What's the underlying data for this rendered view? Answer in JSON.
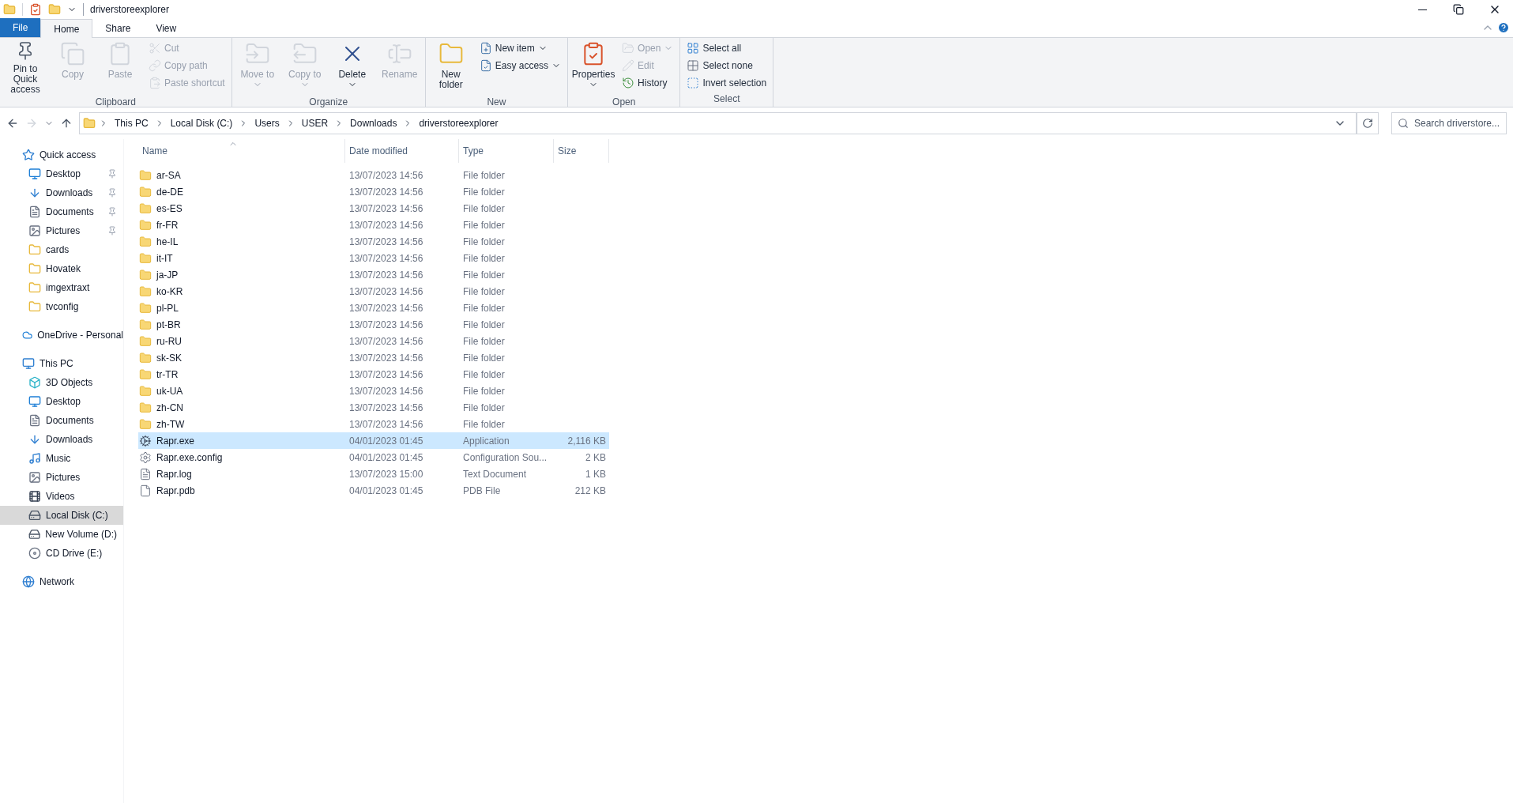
{
  "window": {
    "title": "driverstoreexplorer"
  },
  "ribbon_tabs": [
    {
      "label": "File",
      "kind": "file",
      "selected": false
    },
    {
      "label": "Home",
      "kind": "tab",
      "selected": true
    },
    {
      "label": "Share",
      "kind": "tab",
      "selected": false
    },
    {
      "label": "View",
      "kind": "tab",
      "selected": false
    }
  ],
  "ribbon_groups": [
    {
      "label": "Clipboard",
      "buttons": [
        {
          "label": "Pin to Quick access",
          "kind": "large",
          "disabled": false,
          "dropdown": false
        },
        {
          "label": "Copy",
          "kind": "large",
          "disabled": true,
          "dropdown": false
        },
        {
          "label": "Paste",
          "kind": "large",
          "disabled": true,
          "dropdown": false
        },
        {
          "label": "Cut",
          "kind": "small",
          "disabled": true,
          "dropdown": false
        },
        {
          "label": "Copy path",
          "kind": "small",
          "disabled": true,
          "dropdown": false
        },
        {
          "label": "Paste shortcut",
          "kind": "small",
          "disabled": true,
          "dropdown": false
        }
      ]
    },
    {
      "label": "Organize",
      "buttons": [
        {
          "label": "Move to",
          "kind": "large",
          "disabled": true,
          "dropdown": true
        },
        {
          "label": "Copy to",
          "kind": "large",
          "disabled": true,
          "dropdown": true
        },
        {
          "label": "Delete",
          "kind": "large",
          "disabled": false,
          "dropdown": true
        },
        {
          "label": "Rename",
          "kind": "large",
          "disabled": true,
          "dropdown": false
        }
      ]
    },
    {
      "label": "New",
      "buttons": [
        {
          "label": "New folder",
          "kind": "large",
          "disabled": false,
          "dropdown": false
        },
        {
          "label": "New item",
          "kind": "small",
          "disabled": false,
          "dropdown": true
        },
        {
          "label": "Easy access",
          "kind": "small",
          "disabled": false,
          "dropdown": true
        }
      ]
    },
    {
      "label": "Open",
      "buttons": [
        {
          "label": "Properties",
          "kind": "large",
          "disabled": false,
          "dropdown": true
        },
        {
          "label": "Open",
          "kind": "small",
          "disabled": true,
          "dropdown": true
        },
        {
          "label": "Edit",
          "kind": "small",
          "disabled": true,
          "dropdown": false
        },
        {
          "label": "History",
          "kind": "small",
          "disabled": false,
          "dropdown": false
        }
      ]
    },
    {
      "label": "Select",
      "buttons": [
        {
          "label": "Select all",
          "kind": "small",
          "disabled": false,
          "dropdown": false
        },
        {
          "label": "Select none",
          "kind": "small",
          "disabled": false,
          "dropdown": false
        },
        {
          "label": "Invert selection",
          "kind": "small",
          "disabled": false,
          "dropdown": false
        }
      ]
    }
  ],
  "address_bar": {
    "path": [
      "This PC",
      "Local Disk (C:)",
      "Users",
      "USER",
      "Downloads",
      "driverstoreexplorer"
    ]
  },
  "search": {
    "placeholder": "Search driverstore..."
  },
  "sidebar": {
    "sections": [
      {
        "label": "Quick access",
        "kind": "star",
        "selected": false,
        "children": [
          {
            "label": "Desktop",
            "kind": "desktop",
            "pinned": true,
            "selected": false
          },
          {
            "label": "Downloads",
            "kind": "downloads",
            "pinned": true,
            "selected": false
          },
          {
            "label": "Documents",
            "kind": "documents",
            "pinned": true,
            "selected": false
          },
          {
            "label": "Pictures",
            "kind": "pictures",
            "pinned": true,
            "selected": false
          },
          {
            "label": "cards",
            "kind": "folder",
            "pinned": false,
            "selected": false
          },
          {
            "label": "Hovatek",
            "kind": "folder",
            "pinned": false,
            "selected": false
          },
          {
            "label": "imgextraxt",
            "kind": "folder",
            "pinned": false,
            "selected": false
          },
          {
            "label": "tvconfig",
            "kind": "folder",
            "pinned": false,
            "selected": false
          }
        ]
      },
      {
        "label": "OneDrive - Personal",
        "kind": "cloud",
        "selected": false
      },
      {
        "label": "This PC",
        "kind": "pc",
        "selected": false,
        "children": [
          {
            "label": "3D Objects",
            "kind": "objects",
            "pinned": false,
            "selected": false
          },
          {
            "label": "Desktop",
            "kind": "desktop",
            "pinned": false,
            "selected": false
          },
          {
            "label": "Documents",
            "kind": "documents",
            "pinned": false,
            "selected": false
          },
          {
            "label": "Downloads",
            "kind": "downloads",
            "pinned": false,
            "selected": false
          },
          {
            "label": "Music",
            "kind": "music",
            "pinned": false,
            "selected": false
          },
          {
            "label": "Pictures",
            "kind": "pictures",
            "pinned": false,
            "selected": false
          },
          {
            "label": "Videos",
            "kind": "videos",
            "pinned": false,
            "selected": false
          },
          {
            "label": "Local Disk (C:)",
            "kind": "disk",
            "pinned": false,
            "selected": true
          },
          {
            "label": "New Volume (D:)",
            "kind": "disk",
            "pinned": false,
            "selected": false
          },
          {
            "label": "CD Drive (E:)",
            "kind": "cd",
            "pinned": false,
            "selected": false
          }
        ]
      },
      {
        "label": "Network",
        "kind": "network",
        "selected": false
      }
    ]
  },
  "table": {
    "columns": [
      "Name",
      "Date modified",
      "Type",
      "Size"
    ],
    "rows": [
      {
        "name": "ar-SA",
        "date": "13/07/2023 14:56",
        "type": "File folder",
        "kind": "folder",
        "selected": false
      },
      {
        "name": "de-DE",
        "date": "13/07/2023 14:56",
        "type": "File folder",
        "kind": "folder",
        "selected": false
      },
      {
        "name": "es-ES",
        "date": "13/07/2023 14:56",
        "type": "File folder",
        "kind": "folder",
        "selected": false
      },
      {
        "name": "fr-FR",
        "date": "13/07/2023 14:56",
        "type": "File folder",
        "kind": "folder",
        "selected": false
      },
      {
        "name": "he-IL",
        "date": "13/07/2023 14:56",
        "type": "File folder",
        "kind": "folder",
        "selected": false
      },
      {
        "name": "it-IT",
        "date": "13/07/2023 14:56",
        "type": "File folder",
        "kind": "folder",
        "selected": false
      },
      {
        "name": "ja-JP",
        "date": "13/07/2023 14:56",
        "type": "File folder",
        "kind": "folder",
        "selected": false
      },
      {
        "name": "ko-KR",
        "date": "13/07/2023 14:56",
        "type": "File folder",
        "kind": "folder",
        "selected": false
      },
      {
        "name": "pl-PL",
        "date": "13/07/2023 14:56",
        "type": "File folder",
        "kind": "folder",
        "selected": false
      },
      {
        "name": "pt-BR",
        "date": "13/07/2023 14:56",
        "type": "File folder",
        "kind": "folder",
        "selected": false
      },
      {
        "name": "ru-RU",
        "date": "13/07/2023 14:56",
        "type": "File folder",
        "kind": "folder",
        "selected": false
      },
      {
        "name": "sk-SK",
        "date": "13/07/2023 14:56",
        "type": "File folder",
        "kind": "folder",
        "selected": false
      },
      {
        "name": "tr-TR",
        "date": "13/07/2023 14:56",
        "type": "File folder",
        "kind": "folder",
        "selected": false
      },
      {
        "name": "uk-UA",
        "date": "13/07/2023 14:56",
        "type": "File folder",
        "kind": "folder",
        "selected": false
      },
      {
        "name": "zh-CN",
        "date": "13/07/2023 14:56",
        "type": "File folder",
        "kind": "folder",
        "selected": false
      },
      {
        "name": "zh-TW",
        "date": "13/07/2023 14:56",
        "type": "File folder",
        "kind": "folder",
        "selected": false
      },
      {
        "name": "Rapr.exe",
        "date": "04/01/2023 01:45",
        "type": "Application",
        "size": "2,116 KB",
        "kind": "app",
        "selected": true
      },
      {
        "name": "Rapr.exe.config",
        "date": "04/01/2023 01:45",
        "type": "Configuration Sou...",
        "size": "2 KB",
        "kind": "config",
        "selected": false
      },
      {
        "name": "Rapr.log",
        "date": "13/07/2023 15:00",
        "type": "Text Document",
        "size": "1 KB",
        "kind": "text",
        "selected": false
      },
      {
        "name": "Rapr.pdb",
        "date": "04/01/2023 01:45",
        "type": "PDB File",
        "size": "212 KB",
        "kind": "file",
        "selected": false
      }
    ]
  }
}
